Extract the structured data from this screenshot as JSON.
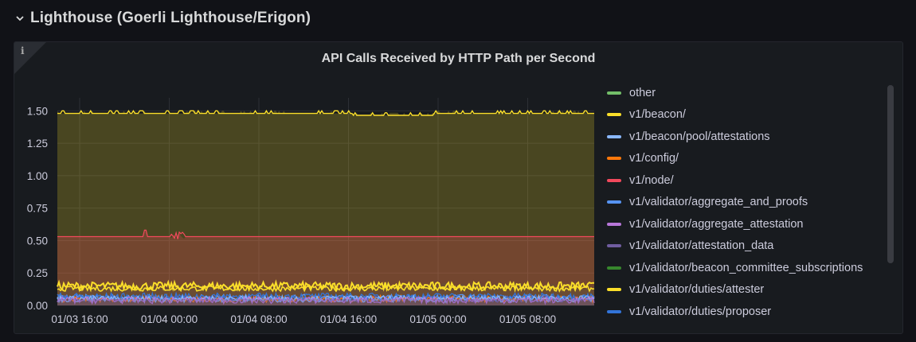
{
  "row": {
    "title": "Lighthouse (Goerli Lighthouse/Erigon)",
    "toggle_icon": "chevron-down-icon"
  },
  "panel": {
    "title": "API Calls Received by HTTP Path per Second",
    "info_icon": "i"
  },
  "chart_data": {
    "type": "area",
    "title": "API Calls Received by HTTP Path per Second",
    "x_ticks": [
      "01/03 16:00",
      "01/04 00:00",
      "01/04 08:00",
      "01/04 16:00",
      "01/05 00:00",
      "01/05 08:00"
    ],
    "y_ticks": [
      "0.00",
      "0.25",
      "0.50",
      "0.75",
      "1.00",
      "1.25",
      "1.50"
    ],
    "ylim": [
      0,
      1.6
    ],
    "grid": true,
    "legend_position": "right",
    "series": [
      {
        "name": "other",
        "color": "#73bf69",
        "level": 0.0
      },
      {
        "name": "v1/beacon/",
        "color": "#fade2a",
        "level": 1.48
      },
      {
        "name": "v1/beacon/pool/attestations",
        "color": "#8ab8ff",
        "level": 0.05
      },
      {
        "name": "v1/config/",
        "color": "#ff780a",
        "level": 0.05
      },
      {
        "name": "v1/node/",
        "color": "#f2495c",
        "level": 0.53
      },
      {
        "name": "v1/validator/aggregate_and_proofs",
        "color": "#5794f2",
        "level": 0.06
      },
      {
        "name": "v1/validator/aggregate_attestation",
        "color": "#b877d9",
        "level": 0.04
      },
      {
        "name": "v1/validator/attestation_data",
        "color": "#705da0",
        "level": 0.05
      },
      {
        "name": "v1/validator/beacon_committee_subscriptions",
        "color": "#37872d",
        "level": 0.03
      },
      {
        "name": "v1/validator/duties/attester",
        "color": "#fade2a",
        "level": 0.15
      },
      {
        "name": "v1/validator/duties/proposer",
        "color": "#3274d9",
        "level": 0.07
      }
    ]
  }
}
